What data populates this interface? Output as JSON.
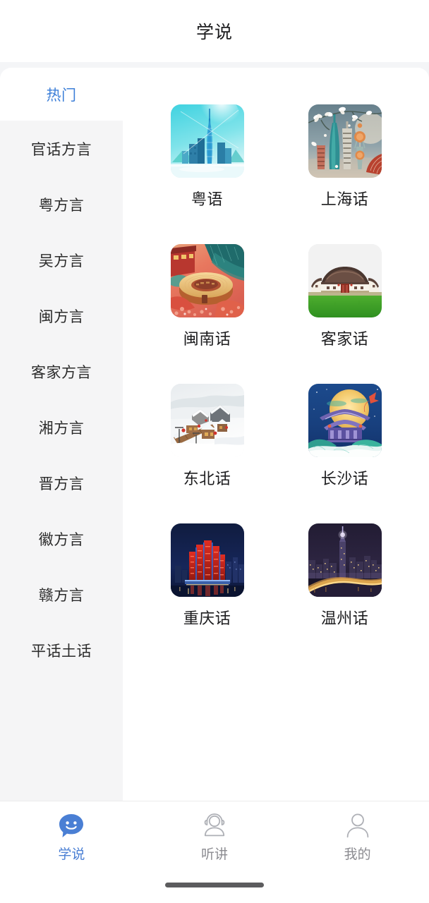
{
  "header": {
    "title": "学说"
  },
  "sidebar": {
    "items": [
      {
        "label": "热门",
        "active": true
      },
      {
        "label": "官话方言",
        "active": false
      },
      {
        "label": "粤方言",
        "active": false
      },
      {
        "label": "吴方言",
        "active": false
      },
      {
        "label": "闽方言",
        "active": false
      },
      {
        "label": "客家方言",
        "active": false
      },
      {
        "label": "湘方言",
        "active": false
      },
      {
        "label": "晋方言",
        "active": false
      },
      {
        "label": "徽方言",
        "active": false
      },
      {
        "label": "赣方言",
        "active": false
      },
      {
        "label": "平话土话",
        "active": false
      }
    ]
  },
  "content": {
    "cards": [
      {
        "label": "粤语",
        "image": "guangzhou-canton-tower-skyline"
      },
      {
        "label": "上海话",
        "image": "shanghai-skyline-magnolia"
      },
      {
        "label": "闽南话",
        "image": "fujian-tulou-roundhouse"
      },
      {
        "label": "客家话",
        "image": "hakka-walled-house-green-field"
      },
      {
        "label": "东北话",
        "image": "northeast-snow-village"
      },
      {
        "label": "长沙话",
        "image": "changsha-pavilion-moon"
      },
      {
        "label": "重庆话",
        "image": "chongqing-raffles-night"
      },
      {
        "label": "温州话",
        "image": "wenzhou-night-cityscape"
      }
    ]
  },
  "tabbar": {
    "tabs": [
      {
        "label": "学说",
        "icon": "speech-bubble-smiley-icon",
        "active": true
      },
      {
        "label": "听讲",
        "icon": "headset-person-icon",
        "active": false
      },
      {
        "label": "我的",
        "icon": "person-icon",
        "active": false
      }
    ]
  },
  "colors": {
    "accent": "#4a7fd4",
    "sidebar_active_text": "#3d7fd8",
    "page_background": "#f4f5f7",
    "sidebar_background": "#f5f5f6",
    "panel_background": "#ffffff",
    "tab_inactive_text": "#8b8b90"
  }
}
